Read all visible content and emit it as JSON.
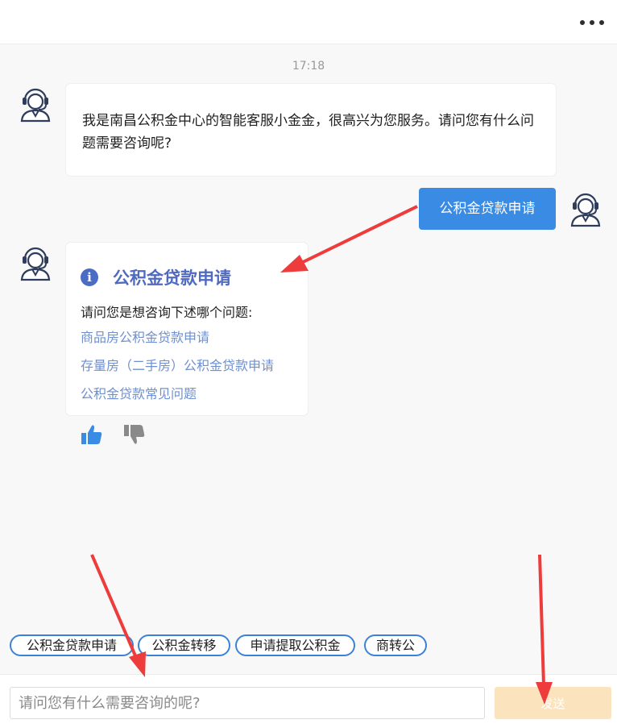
{
  "header": {
    "menu_icon": "more-horizontal-icon"
  },
  "chat": {
    "timestamp": "17:18",
    "welcome_text": "我是南昌公积金中心的智能客服小金金，很高兴为您服务。请问您有什么问题需要咨询呢?",
    "user_message": "公积金贷款申请",
    "reply": {
      "title": "公积金贷款申请",
      "prompt": "请问您是想咨询下述哪个问题:",
      "options": [
        "商品房公积金贷款申请",
        "存量房（二手房）公积金贷款申请",
        "公积金贷款常见问题"
      ]
    },
    "feedback": {
      "like_icon": "thumbs-up-icon",
      "dislike_icon": "thumbs-down-icon"
    }
  },
  "quick_replies": [
    "公积金贷款申请",
    "公积金转移",
    "申请提取公积金",
    "商转公"
  ],
  "composer": {
    "placeholder": "请问您有什么需要咨询的呢?",
    "send_label": "发送"
  },
  "colors": {
    "accent": "#3a8be4",
    "link": "#6f90d0",
    "title": "#4f6ac0",
    "send_bg": "#fbe3bd",
    "annotation_arrow": "#ee3b3b"
  }
}
